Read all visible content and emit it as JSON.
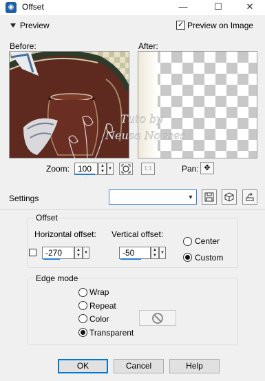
{
  "window": {
    "title": "Offset",
    "minimize_glyph": "—",
    "maximize_glyph": "☐",
    "close_glyph": "✕"
  },
  "preview": {
    "section_label": "Preview",
    "preview_on_image_label": "Preview on Image",
    "preview_on_image_checked": true,
    "before_label": "Before:",
    "after_label": "After:",
    "zoom_label": "Zoom:",
    "zoom_value": "100",
    "pan_label": "Pan:"
  },
  "settings": {
    "label": "Settings",
    "preset_value": ""
  },
  "offset": {
    "group_title": "Offset",
    "horizontal_label": "Horizontal offset:",
    "horizontal_value": "-270",
    "vertical_label": "Vertical offset:",
    "vertical_value": "-50",
    "center_label": "Center",
    "custom_label": "Custom",
    "selected": "Custom"
  },
  "edge_mode": {
    "group_title": "Edge mode",
    "options": [
      "Wrap",
      "Repeat",
      "Color",
      "Transparent"
    ],
    "selected": "Transparent"
  },
  "buttons": {
    "ok": "OK",
    "cancel": "Cancel",
    "help": "Help"
  },
  "watermark_lines": [
    "Tuto by",
    "Neusa Novaes"
  ],
  "colors": {
    "accent": "#0078d7",
    "field_underline": "#2b7bd4"
  }
}
